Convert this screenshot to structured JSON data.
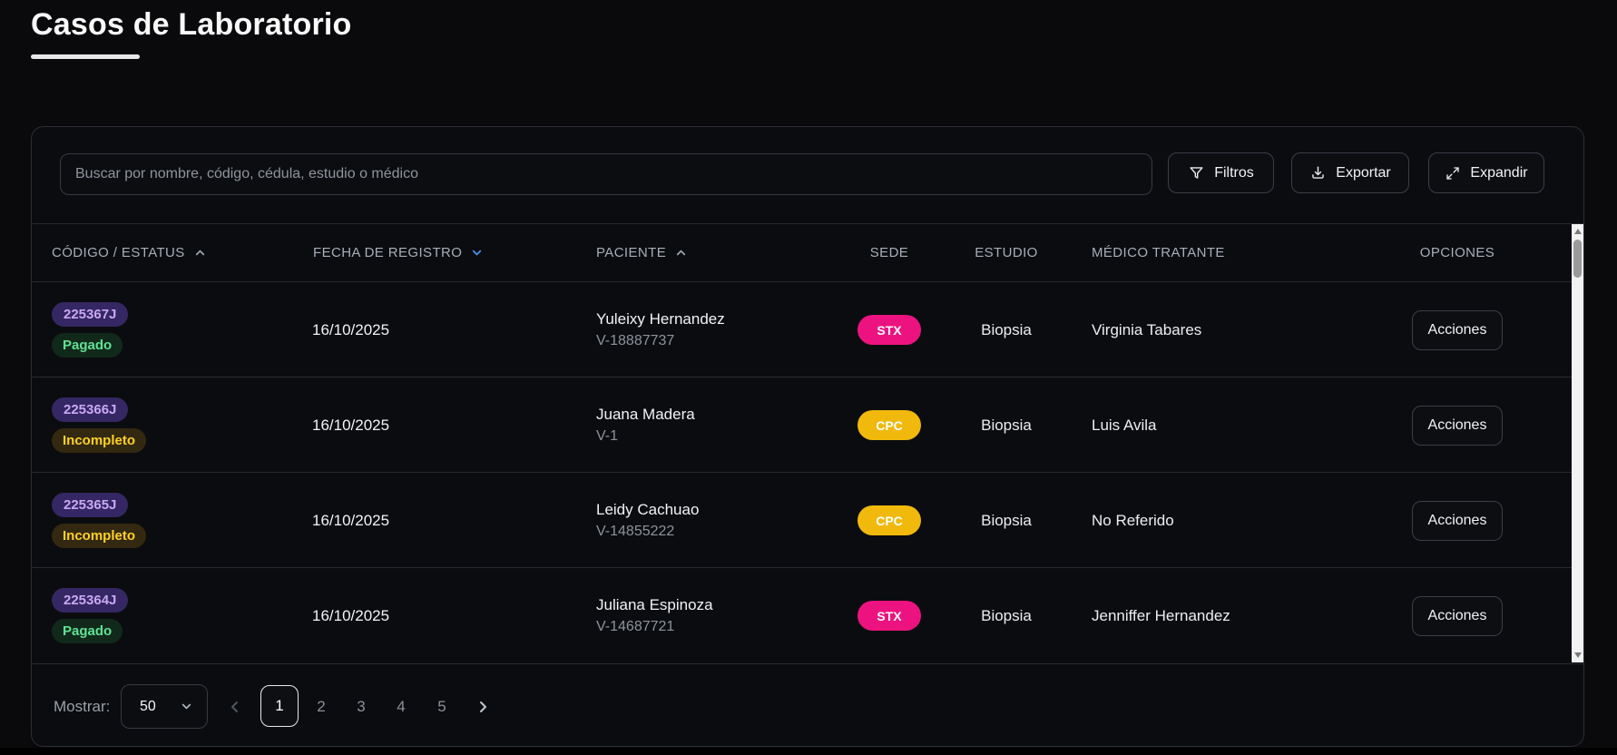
{
  "page": {
    "title": "Casos de Laboratorio"
  },
  "toolbar": {
    "search_placeholder": "Buscar por nombre, código, cédula, estudio o médico",
    "filters_label": "Filtros",
    "export_label": "Exportar",
    "expand_label": "Expandir"
  },
  "table": {
    "columns": {
      "code_status": "CÓDIGO / ESTATUS",
      "date": "FECHA DE REGISTRO",
      "patient": "PACIENTE",
      "sede": "SEDE",
      "study": "ESTUDIO",
      "doctor": "MÉDICO TRATANTE",
      "options": "OPCIONES"
    },
    "sort": {
      "code_status": "asc",
      "date": "desc-active",
      "patient": "asc"
    },
    "action_label": "Acciones",
    "rows": [
      {
        "code": "225367J",
        "status": "Pagado",
        "date": "16/10/2025",
        "patient": "Yuleixy Hernandez",
        "document": "V-18887737",
        "sede": "STX",
        "study": "Biopsia",
        "doctor": "Virginia Tabares"
      },
      {
        "code": "225366J",
        "status": "Incompleto",
        "date": "16/10/2025",
        "patient": "Juana Madera",
        "document": "V-1",
        "sede": "CPC",
        "study": "Biopsia",
        "doctor": "Luis Avila"
      },
      {
        "code": "225365J",
        "status": "Incompleto",
        "date": "16/10/2025",
        "patient": "Leidy Cachuao",
        "document": "V-14855222",
        "sede": "CPC",
        "study": "Biopsia",
        "doctor": "No Referido"
      },
      {
        "code": "225364J",
        "status": "Pagado",
        "date": "16/10/2025",
        "patient": "Juliana Espinoza",
        "document": "V-14687721",
        "sede": "STX",
        "study": "Biopsia",
        "doctor": "Jenniffer Hernandez"
      }
    ]
  },
  "pagination": {
    "show_label": "Mostrar:",
    "page_size": "50",
    "pages": [
      "1",
      "2",
      "3",
      "4",
      "5"
    ],
    "active_page": "1"
  },
  "colors": {
    "sede_stx": "#ec1380",
    "sede_cpc": "#f0b90b",
    "status_paid_text": "#5fe394",
    "status_incomplete_text": "#ffd21e",
    "code_badge_text": "#c9a8f5",
    "sort_active": "#4a8fe7",
    "card_background": "#0b0c0f"
  }
}
